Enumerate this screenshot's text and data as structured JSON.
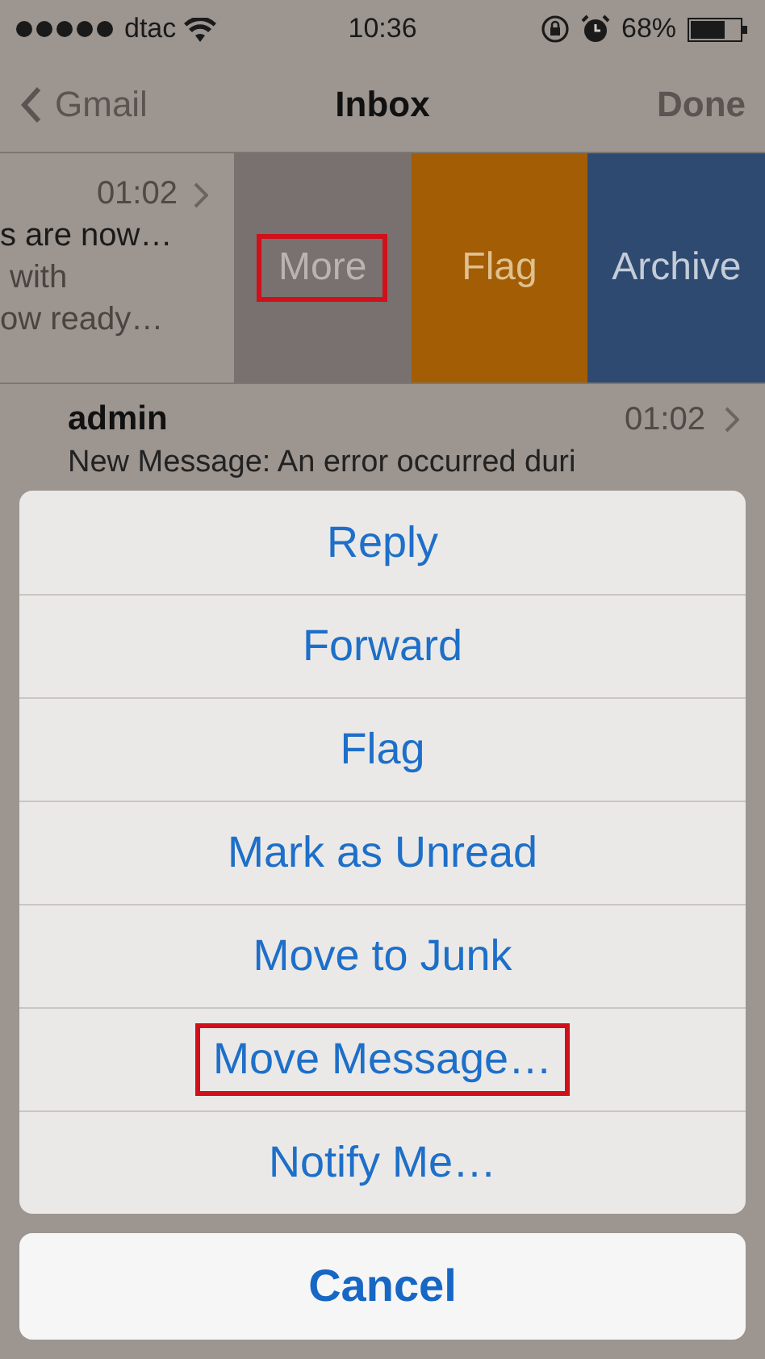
{
  "status_bar": {
    "carrier": "dtac",
    "time": "10:36",
    "battery": "68%"
  },
  "nav": {
    "back": "Gmail",
    "title": "Inbox",
    "action": "Done"
  },
  "swiped_row": {
    "time": "01:02",
    "lines": [
      "s are now…",
      "with",
      "ow ready…"
    ],
    "actions": [
      {
        "label": "More",
        "kind": "more",
        "highlighted": true
      },
      {
        "label": "Flag",
        "kind": "flag",
        "highlighted": false
      },
      {
        "label": "Archive",
        "kind": "archive",
        "highlighted": false
      }
    ]
  },
  "message_row": {
    "sender": "admin",
    "time": "01:02",
    "preview": "New Message: An error occurred duri"
  },
  "action_sheet": {
    "items": [
      {
        "label": "Reply",
        "highlighted": false
      },
      {
        "label": "Forward",
        "highlighted": false
      },
      {
        "label": "Flag",
        "highlighted": false
      },
      {
        "label": "Mark as Unread",
        "highlighted": false
      },
      {
        "label": "Move to Junk",
        "highlighted": false
      },
      {
        "label": "Move Message…",
        "highlighted": true
      },
      {
        "label": "Notify Me…",
        "highlighted": false
      }
    ],
    "cancel": "Cancel"
  }
}
